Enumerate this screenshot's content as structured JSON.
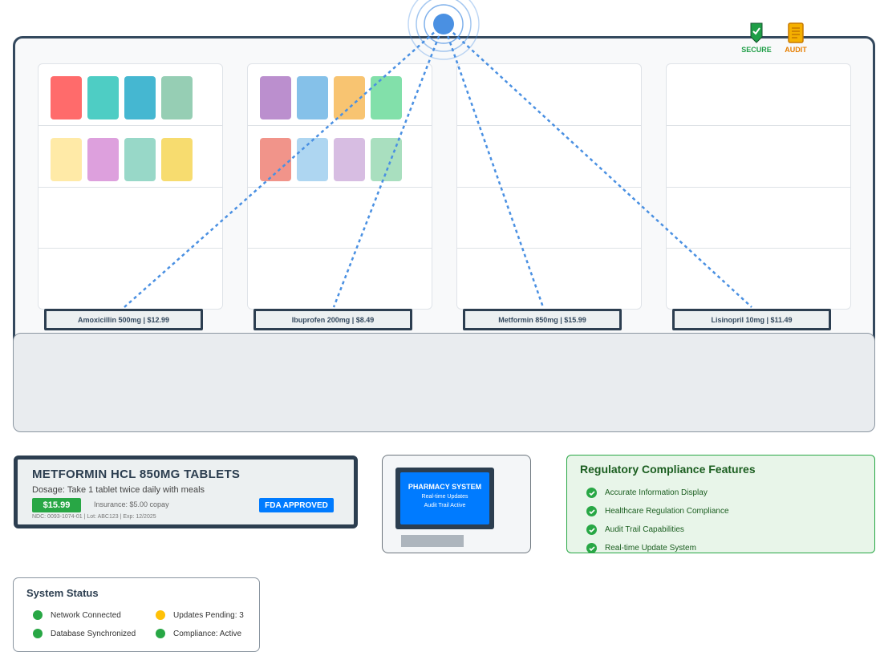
{
  "badges": {
    "secure": "SECURE",
    "audit": "AUDIT"
  },
  "colors": {
    "network": "#4a90e2",
    "success": "#28a745",
    "warning": "#ffc107",
    "primary": "#007bff",
    "dark": "#2c3e50"
  },
  "price_tags": [
    "Amoxicillin 500mg | $12.99",
    "Ibuprofen 200mg | $8.49",
    "Metformin 850mg | $15.99",
    "Lisinopril 10mg | $11.49"
  ],
  "product": {
    "title": "METFORMIN HCL 850MG TABLETS",
    "dosage": "Dosage: Take 1 tablet twice daily with meals",
    "price": "$15.99",
    "insurance": "Insurance: $5.00 copay",
    "fda": "FDA APPROVED",
    "ndc": "NDC: 0093-1074-01 | Lot: ABC123 | Exp: 12/2025"
  },
  "terminal": {
    "title": "PHARMACY SYSTEM",
    "line1": "Real-time Updates",
    "line2": "Audit Trail Active"
  },
  "compliance": {
    "title": "Regulatory Compliance Features",
    "items": [
      "Accurate Information Display",
      "Healthcare Regulation Compliance",
      "Audit Trail Capabilities",
      "Real-time Update System"
    ]
  },
  "status": {
    "title": "System Status",
    "network": "Network Connected",
    "database": "Database Synchronized",
    "updates": "Updates Pending: 3",
    "compliance": "Compliance: Active"
  }
}
